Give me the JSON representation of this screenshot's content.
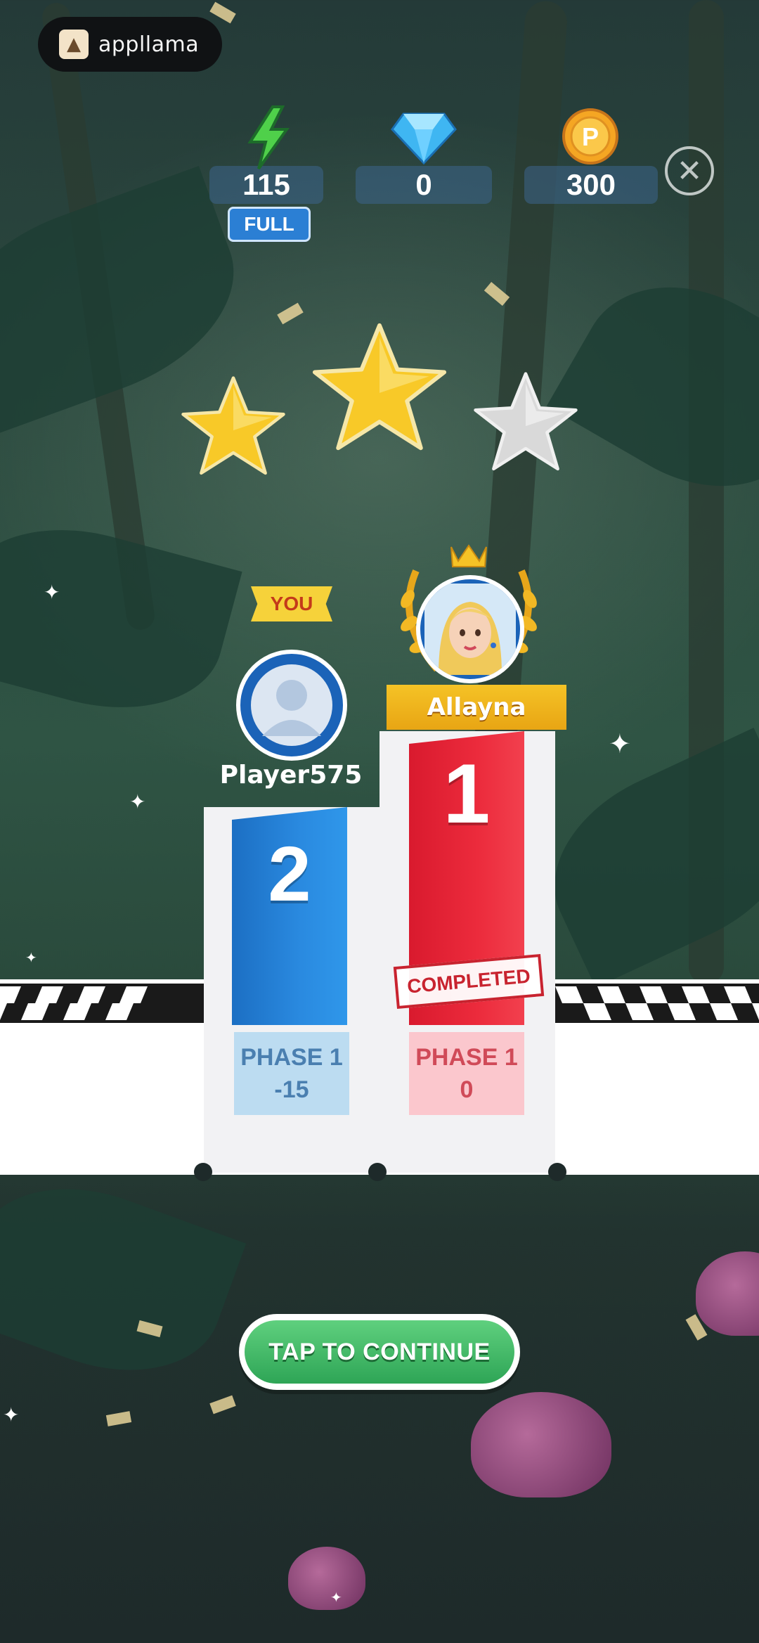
{
  "brand": {
    "name": "appllama"
  },
  "resources": {
    "energy": {
      "value": "115",
      "badge": "FULL",
      "icon": "lightning-icon"
    },
    "gems": {
      "value": "0",
      "icon": "diamond-icon"
    },
    "coins": {
      "value": "300",
      "icon": "coin-icon"
    }
  },
  "stars": {
    "earned": 2,
    "total": 3
  },
  "podium": {
    "player": {
      "tag": "YOU",
      "name": "Player575",
      "rank": "2",
      "phase": "PHASE 1",
      "score": "-15"
    },
    "winner": {
      "name": "Allayna",
      "rank": "1",
      "status": "COMPLETED",
      "phase": "PHASE 1",
      "score": "0"
    }
  },
  "actions": {
    "continue_label": "TAP TO CONTINUE"
  },
  "colors": {
    "blue": "#2a8ae0",
    "red": "#ec2b3c",
    "green": "#2ea556",
    "gold": "#f5c326"
  }
}
